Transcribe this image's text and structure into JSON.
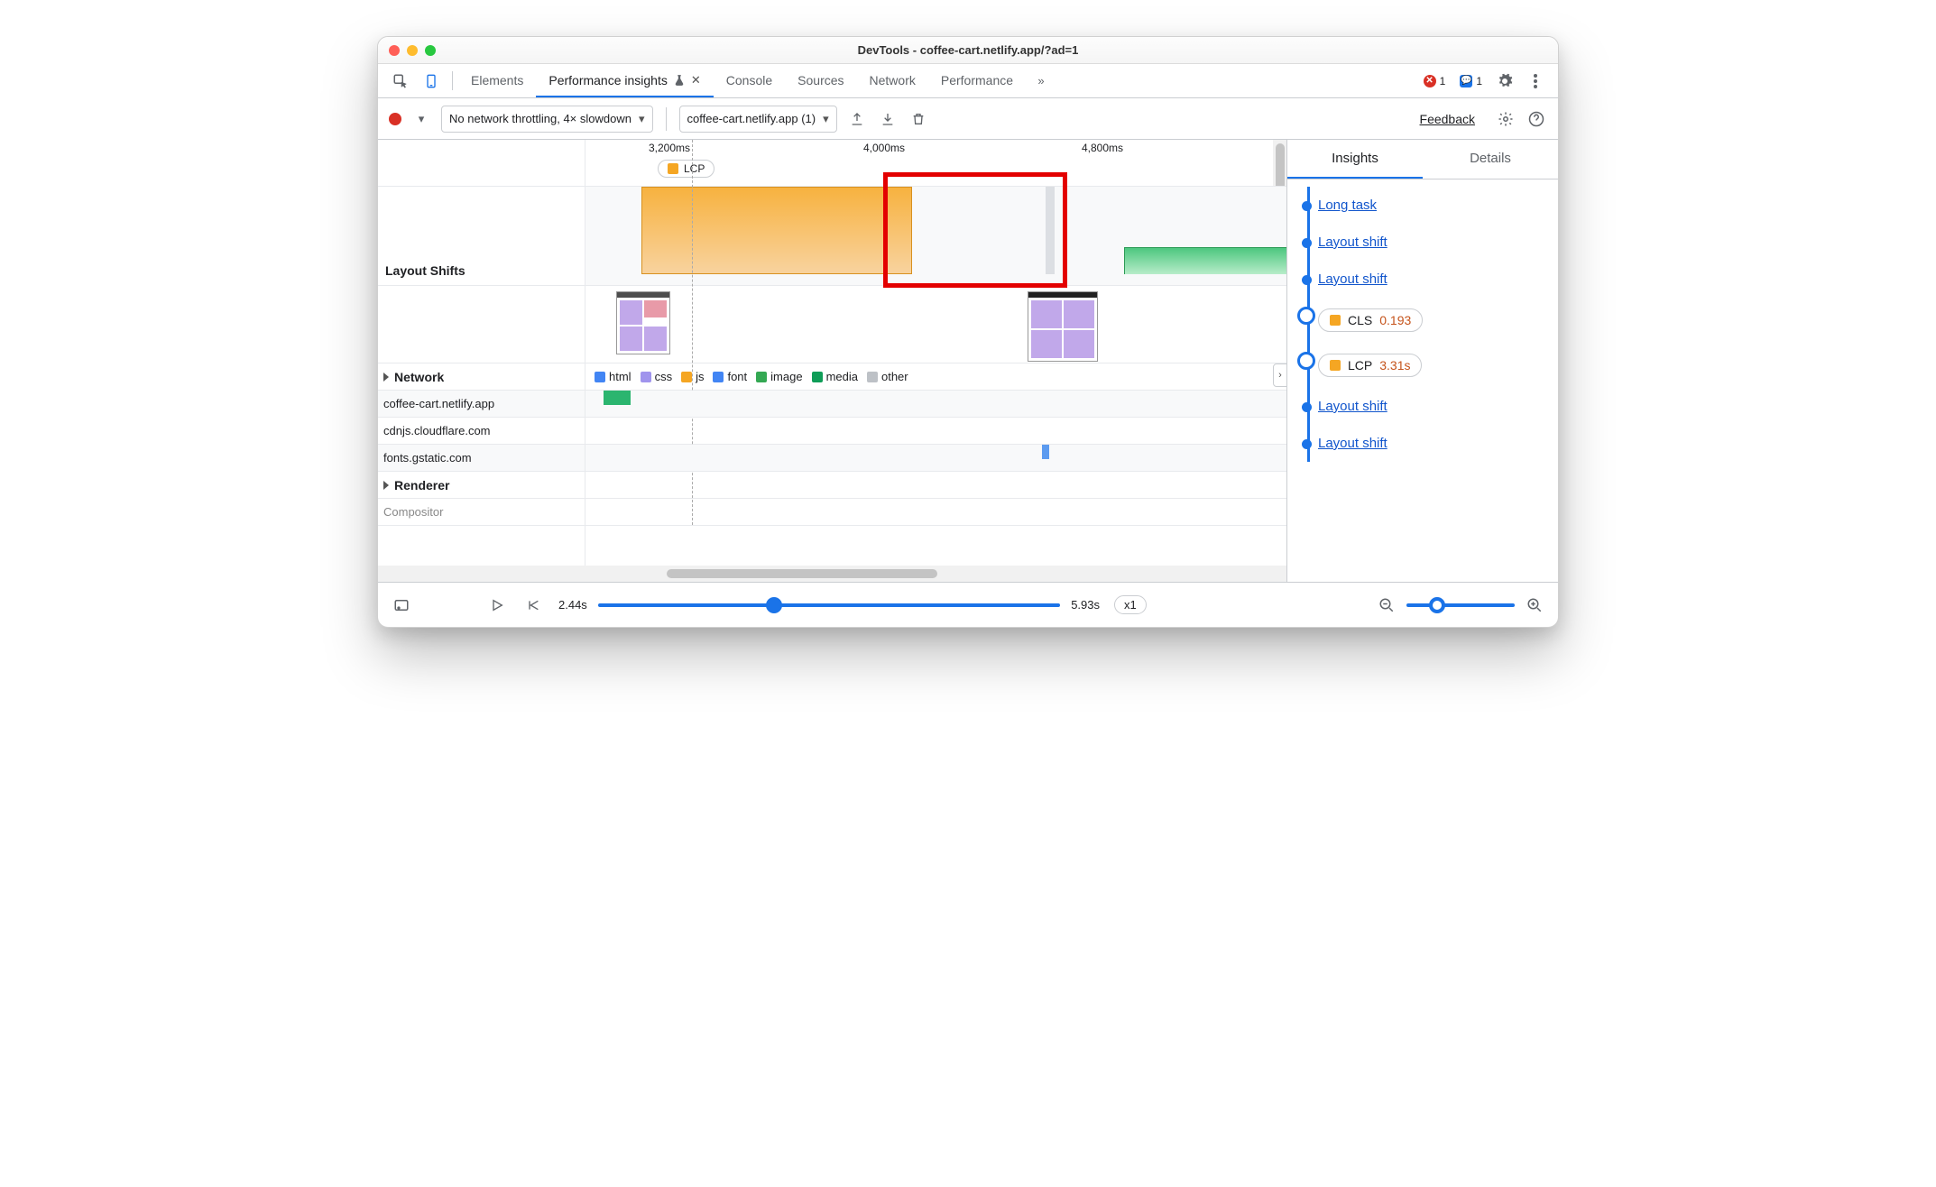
{
  "window_title": "DevTools - coffee-cart.netlify.app/?ad=1",
  "top_tabs": {
    "elements": "Elements",
    "perf_insights": "Performance insights",
    "console": "Console",
    "sources": "Sources",
    "network": "Network",
    "performance": "Performance"
  },
  "top_badges": {
    "errors": "1",
    "messages": "1"
  },
  "toolbar": {
    "throttling": "No network throttling, 4× slowdown",
    "recording_select": "coffee-cart.netlify.app (1)",
    "feedback": "Feedback"
  },
  "ruler": {
    "t1": "3,200ms",
    "t2": "4,000ms",
    "t3": "4,800ms",
    "lcp": "LCP"
  },
  "rows": {
    "layout_shifts": "Layout Shifts",
    "network": "Network",
    "renderer": "Renderer",
    "compositor": "Compositor"
  },
  "legend": {
    "html": "html",
    "css": "css",
    "js": "js",
    "font": "font",
    "image": "image",
    "media": "media",
    "other": "other"
  },
  "hosts": {
    "h1": "coffee-cart.netlify.app",
    "h2": "cdnjs.cloudflare.com",
    "h3": "fonts.gstatic.com"
  },
  "right_tabs": {
    "insights": "Insights",
    "details": "Details"
  },
  "insights": {
    "long_task": "Long task",
    "layout_shift": "Layout shift",
    "cls_label": "CLS",
    "cls_val": "0.193",
    "lcp_label": "LCP",
    "lcp_val": "3.31s"
  },
  "bottom": {
    "start": "2.44s",
    "end": "5.93s",
    "speed": "x1"
  }
}
